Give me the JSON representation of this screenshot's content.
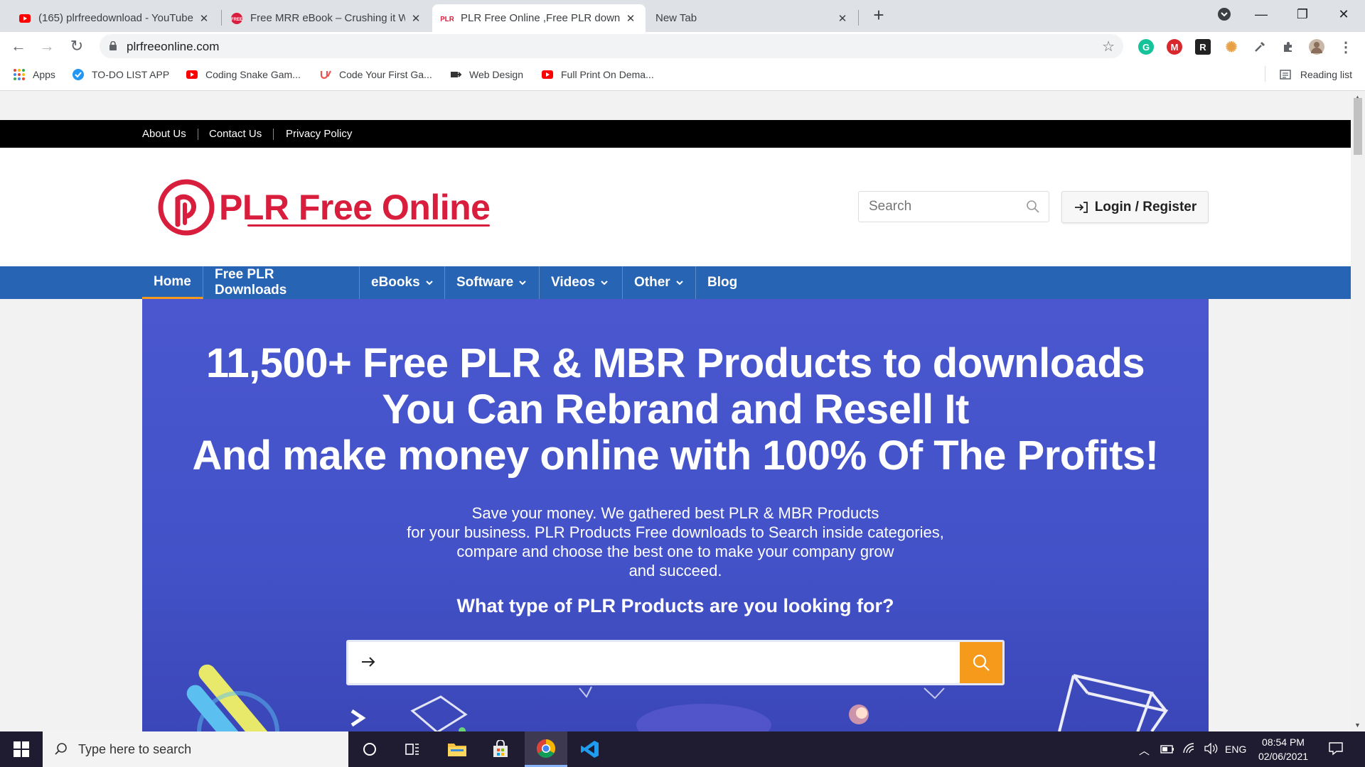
{
  "browser": {
    "tabs": [
      {
        "title": "(165) plrfreedownload - YouTube",
        "favicon": "youtube-icon",
        "active": false
      },
      {
        "title": "Free MRR eBook – Crushing it Wi",
        "favicon": "free-badge-icon",
        "active": false
      },
      {
        "title": "PLR Free Online ,Free PLR downlo",
        "favicon": "plr-icon",
        "active": true
      },
      {
        "title": "New Tab",
        "favicon": "",
        "active": false
      }
    ],
    "url": "plrfreeonline.com",
    "bookmarks": [
      {
        "label": "Apps",
        "icon": "apps-grid-icon"
      },
      {
        "label": "TO-DO LIST APP",
        "icon": "todo-app-icon"
      },
      {
        "label": "Coding Snake Gam...",
        "icon": "youtube-icon"
      },
      {
        "label": "Code Your First Ga...",
        "icon": "udemy-icon"
      },
      {
        "label": "Web Design",
        "icon": "web-design-icon"
      },
      {
        "label": "Full Print On Dema...",
        "icon": "youtube-icon"
      }
    ],
    "reading_list": "Reading list",
    "extensions": [
      {
        "name": "grammarly-icon",
        "letter": "G",
        "color": "#15c39a"
      },
      {
        "name": "mega-icon",
        "letter": "M",
        "color": "#d9272e"
      },
      {
        "name": "r-extension-icon",
        "letter": "R",
        "color": "#222222"
      },
      {
        "name": "gear-extension-icon",
        "letter": "✺",
        "color": "#e8a045"
      },
      {
        "name": "eyedropper-icon",
        "letter": "",
        "color": "#5f6368"
      },
      {
        "name": "puzzle-icon",
        "letter": "",
        "color": "#5f6368"
      }
    ]
  },
  "site": {
    "top_links": [
      "About Us",
      "Contact Us",
      "Privacy Policy"
    ],
    "logo_text": "PLR Free Online",
    "search_placeholder": "Search",
    "login_label": "Login / Register",
    "nav": [
      {
        "label": "Home",
        "dropdown": false,
        "active": true
      },
      {
        "label": "Free PLR Downloads",
        "dropdown": false,
        "active": false
      },
      {
        "label": "eBooks",
        "dropdown": true,
        "active": false
      },
      {
        "label": "Software",
        "dropdown": true,
        "active": false
      },
      {
        "label": "Videos",
        "dropdown": true,
        "active": false
      },
      {
        "label": "Other",
        "dropdown": true,
        "active": false
      },
      {
        "label": "Blog",
        "dropdown": false,
        "active": false
      }
    ],
    "hero": {
      "title_lines": [
        "11,500+ Free PLR & MBR Products to downloads",
        "You Can Rebrand and Resell It",
        "And make money online with 100% Of The Profits!"
      ],
      "subtitle_lines": [
        "Save your money. We gathered best PLR & MBR Products",
        "for your business. PLR Products Free downloads to Search inside categories,",
        "compare and choose the best one to make your company grow",
        "and succeed."
      ],
      "question": "What type of PLR Products are you looking for?"
    },
    "colors": {
      "brand_red": "#d81e3c",
      "nav_blue": "#2864b4",
      "accent_orange": "#f59a1b",
      "hero_blue": "#4a57cf"
    }
  },
  "taskbar": {
    "search_placeholder": "Type here to search",
    "language": "ENG",
    "time": "08:54 PM",
    "date": "02/06/2021"
  }
}
